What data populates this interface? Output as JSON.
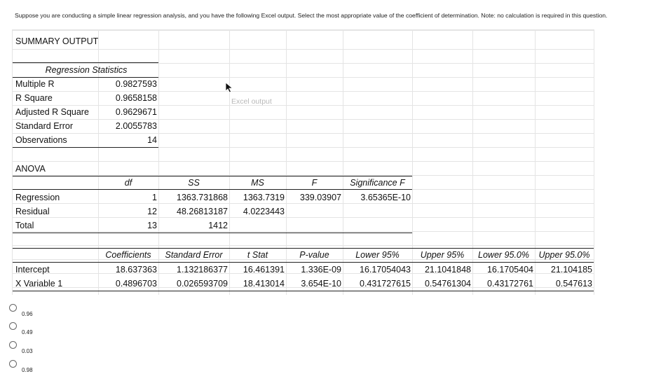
{
  "question": "Suppose you are conducting a simple linear regression analysis, and you have the following Excel output. Select the most appropriate value of the coefficient of determination. Note: no calculation is required in this question.",
  "sheet": {
    "summary_title": "SUMMARY OUTPUT",
    "regression_stats": {
      "header": "Regression Statistics",
      "rows": [
        {
          "label": "Multiple R",
          "value": "0.9827593"
        },
        {
          "label": "R Square",
          "value": "0.9658158"
        },
        {
          "label": "Adjusted R Square",
          "value": "0.9629671"
        },
        {
          "label": "Standard Error",
          "value": "2.0055783"
        },
        {
          "label": "Observations",
          "value": "14"
        }
      ]
    },
    "watermark": "Excel output",
    "anova": {
      "title": "ANOVA",
      "headers": [
        "df",
        "SS",
        "MS",
        "F",
        "Significance F"
      ],
      "rows": [
        {
          "label": "Regression",
          "df": "1",
          "ss": "1363.731868",
          "ms": "1363.7319",
          "f": "339.03907",
          "sig": "3.65365E-10"
        },
        {
          "label": "Residual",
          "df": "12",
          "ss": "48.26813187",
          "ms": "4.0223443",
          "f": "",
          "sig": ""
        },
        {
          "label": "Total",
          "df": "13",
          "ss": "1412",
          "ms": "",
          "f": "",
          "sig": ""
        }
      ]
    },
    "coefficients": {
      "headers": [
        "Coefficients",
        "Standard Error",
        "t Stat",
        "P-value",
        "Lower 95%",
        "Upper 95%",
        "Lower 95.0%",
        "Upper 95.0%"
      ],
      "rows": [
        {
          "label": "Intercept",
          "values": [
            "18.637363",
            "1.132186377",
            "16.461391",
            "1.336E-09",
            "16.17054043",
            "21.1041848",
            "16.1705404",
            "21.104185"
          ]
        },
        {
          "label": "X Variable 1",
          "values": [
            "0.4896703",
            "0.026593709",
            "18.413014",
            "3.654E-10",
            "0.431727615",
            "0.54761304",
            "0.43172761",
            "0.547613"
          ]
        }
      ]
    }
  },
  "options": [
    {
      "label": "0.96"
    },
    {
      "label": "0.49"
    },
    {
      "label": "0.03"
    },
    {
      "label": "0.98"
    }
  ]
}
